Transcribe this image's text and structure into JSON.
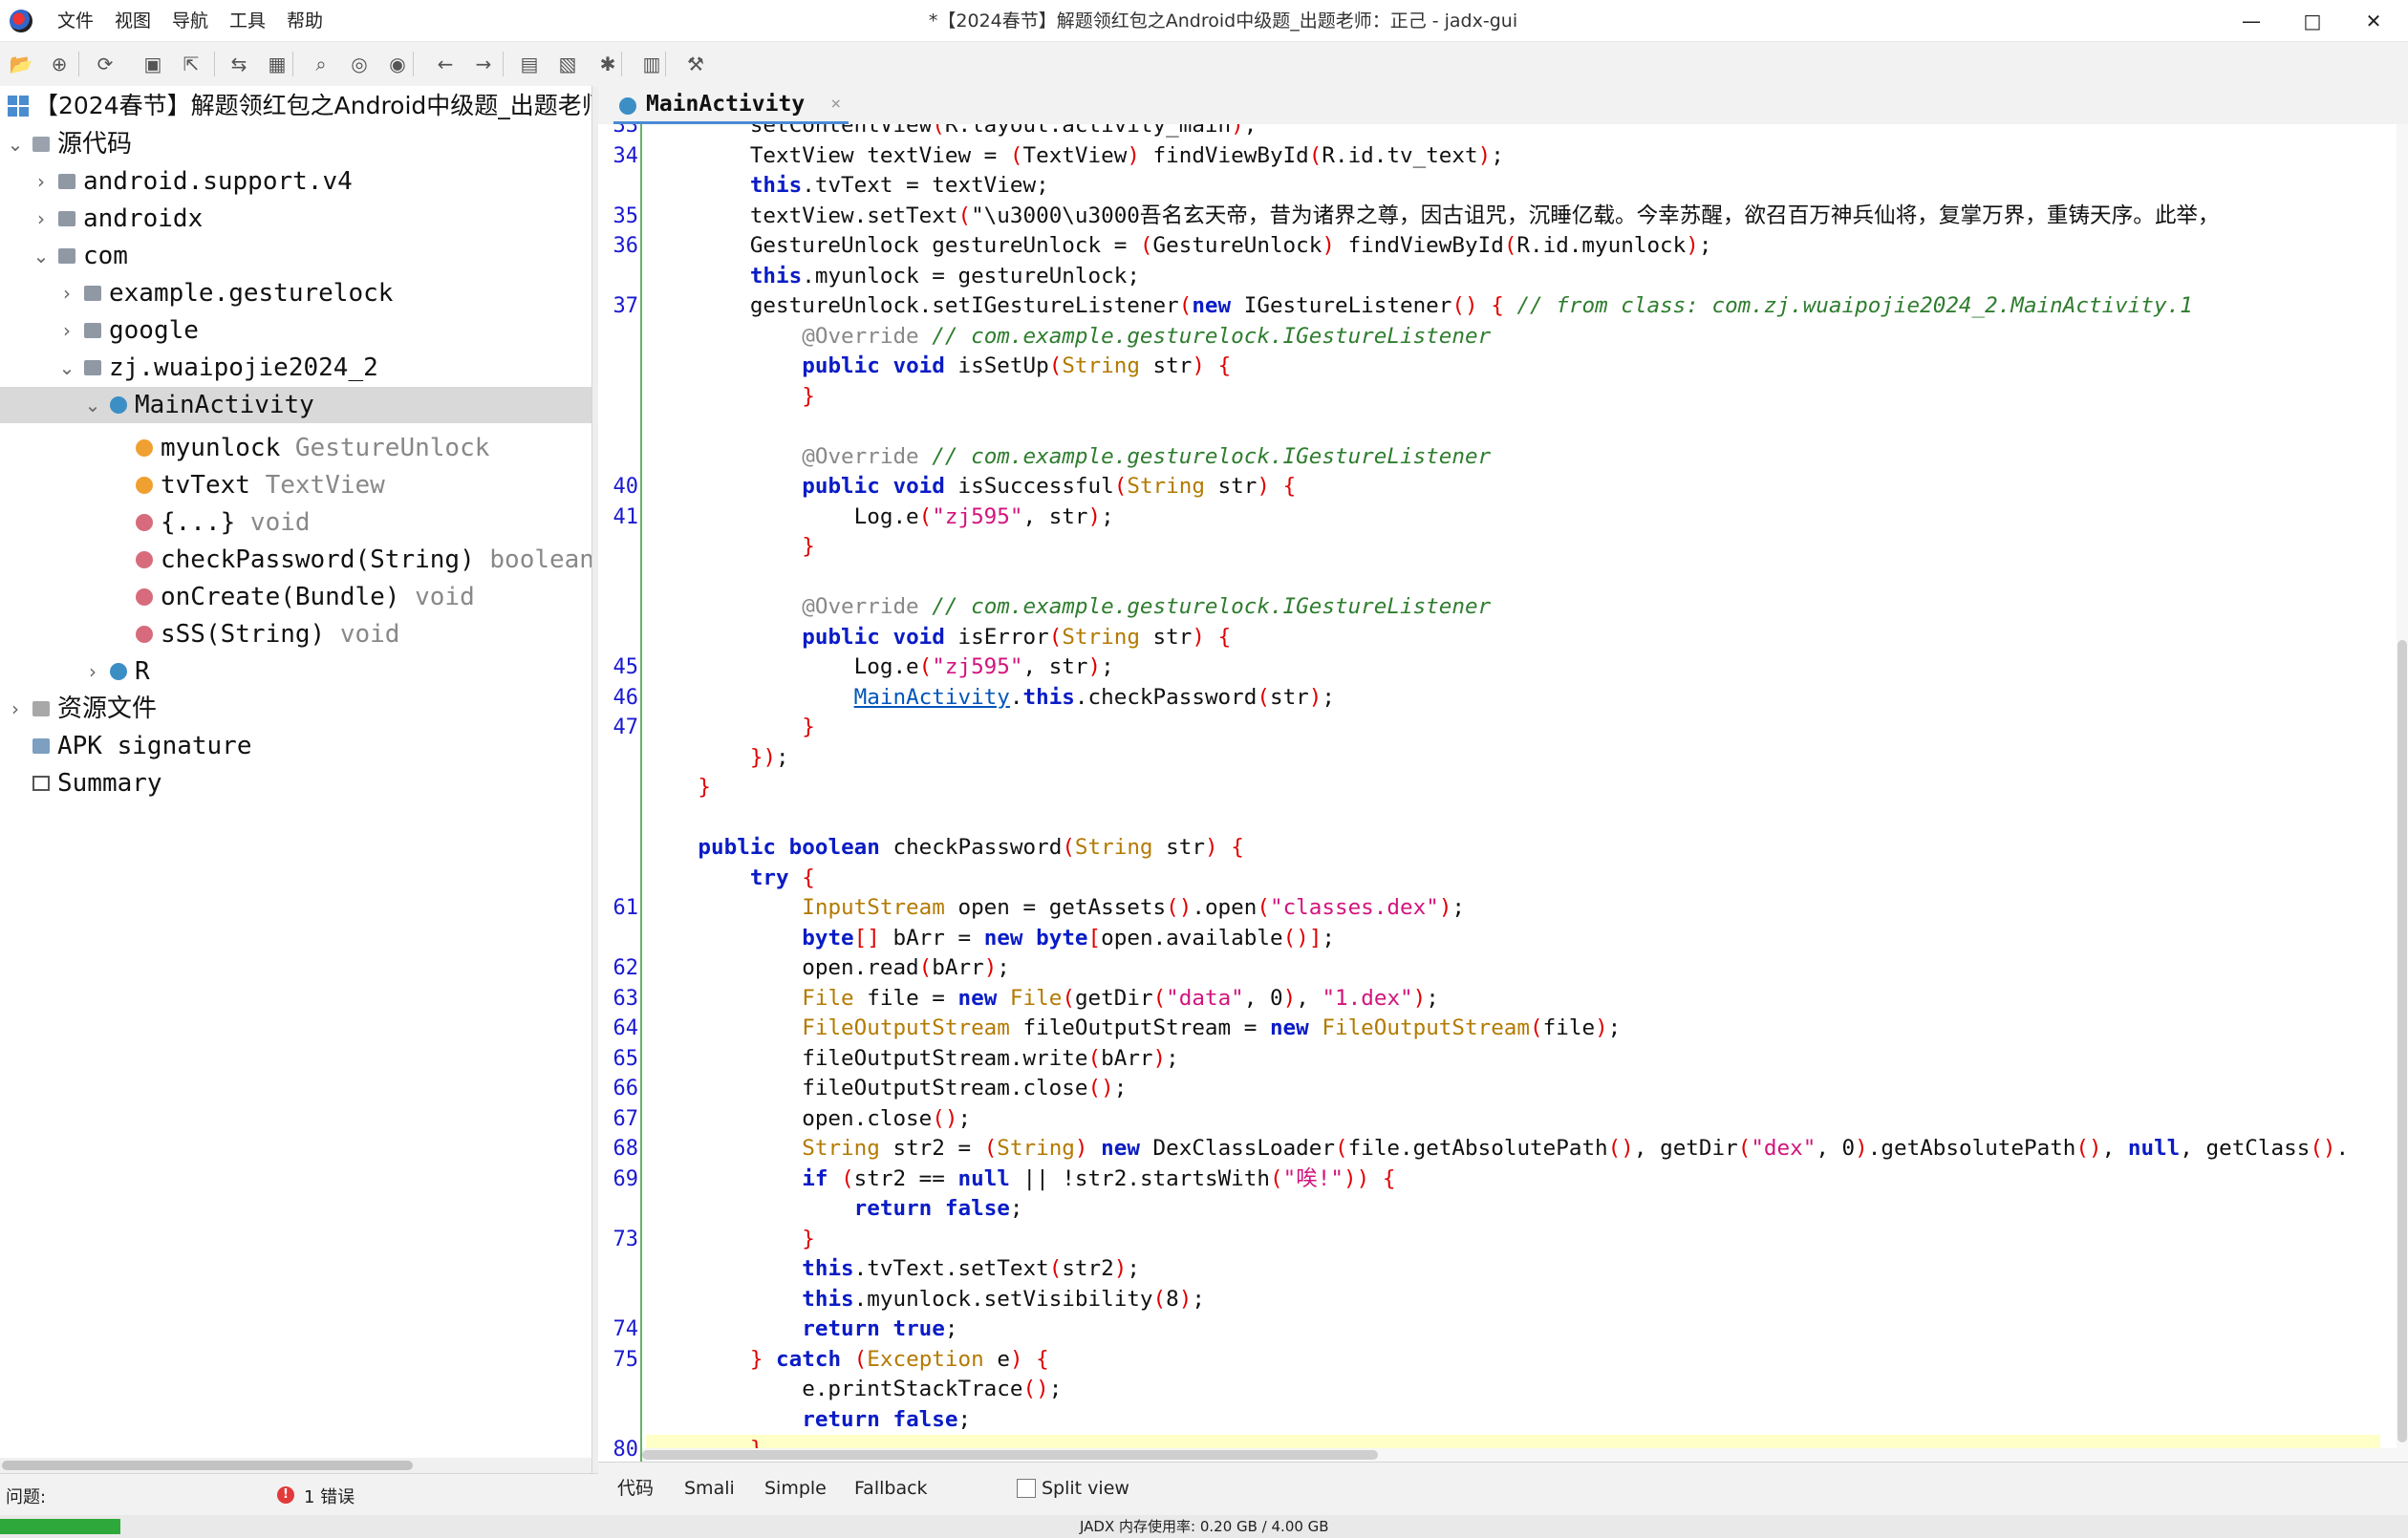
{
  "window": {
    "title": "*【2024春节】解题领红包之Android中级题_出题老师：正己 - jadx-gui",
    "menu": [
      "文件",
      "视图",
      "导航",
      "工具",
      "帮助"
    ],
    "controls": {
      "minimize": "—",
      "maximize": "□",
      "close": "✕"
    }
  },
  "toolbar": {
    "buttons": [
      "open-icon",
      "add-files-icon",
      "reload-icon",
      "save-icon",
      "export-icon",
      "sync-icon",
      "flatten-icon",
      "search-icon",
      "find-class-icon",
      "find-usage-icon",
      "back-icon",
      "forward-icon",
      "log-icon",
      "bookmark-icon",
      "debug-icon",
      "log-viewer-icon",
      "settings-icon"
    ]
  },
  "tree": [
    {
      "label": "【2024春节】解题领红包之Android中级题_出题老师：正己",
      "type": "",
      "icon": "project-icon",
      "arrow": ""
    },
    {
      "label": "源代码",
      "type": "",
      "icon": "source-icon",
      "arrow": "⌄"
    },
    {
      "label": "android.support.v4",
      "type": "",
      "icon": "package-icon",
      "arrow": "›"
    },
    {
      "label": "androidx",
      "type": "",
      "icon": "package-icon",
      "arrow": "›"
    },
    {
      "label": "com",
      "type": "",
      "icon": "package-icon",
      "arrow": "⌄"
    },
    {
      "label": "example.gesturelock",
      "type": "",
      "icon": "package-icon",
      "arrow": "›"
    },
    {
      "label": "google",
      "type": "",
      "icon": "package-icon",
      "arrow": "›"
    },
    {
      "label": "zj.wuaipojie2024_2",
      "type": "",
      "icon": "package-icon",
      "arrow": "⌄"
    },
    {
      "label": "MainActivity",
      "type": "",
      "icon": "class-icon",
      "arrow": "⌄"
    },
    {
      "label": "myunlock",
      "type": "GestureUnlock",
      "icon": "field-icon",
      "arrow": ""
    },
    {
      "label": "tvText",
      "type": "TextView",
      "icon": "field-icon",
      "arrow": ""
    },
    {
      "label": "{...}",
      "type": "void",
      "icon": "method-icon",
      "arrow": ""
    },
    {
      "label": "checkPassword(String)",
      "type": "boolean",
      "icon": "method-icon",
      "arrow": ""
    },
    {
      "label": "onCreate(Bundle)",
      "type": "void",
      "icon": "method-icon",
      "arrow": ""
    },
    {
      "label": "sSS(String)",
      "type": "void",
      "icon": "method-icon",
      "arrow": ""
    },
    {
      "label": "R",
      "type": "",
      "icon": "class-icon",
      "arrow": "›"
    },
    {
      "label": "资源文件",
      "type": "",
      "icon": "resources-icon",
      "arrow": "›"
    },
    {
      "label": "APK signature",
      "type": "",
      "icon": "signature-icon",
      "arrow": ""
    },
    {
      "label": "Summary",
      "type": "",
      "icon": "summary-icon",
      "arrow": ""
    }
  ],
  "editor": {
    "tab_label": "MainActivity",
    "tab_close": "×",
    "line_numbers": [
      "33",
      "34",
      "",
      "35",
      "36",
      "",
      "37",
      "",
      "",
      "",
      "",
      "",
      "40",
      "41",
      "",
      "",
      "",
      "",
      "45",
      "46",
      "47",
      "",
      "",
      "",
      "",
      "",
      "61",
      "",
      "62",
      "63",
      "64",
      "65",
      "66",
      "67",
      "68",
      "69",
      "",
      "73",
      "",
      "",
      "74",
      "75",
      "",
      "",
      "80",
      "",
      ""
    ],
    "code": [
      "        setContentView(R.layout.activity_main);",
      "        TextView textView = (TextView) findViewById(R.id.tv_text);",
      "        this.tvText = textView;",
      "        textView.setText(\"\\u3000\\u3000吾名玄天帝，昔为诸界之尊，因古诅咒，沉睡亿载。今幸苏醒，欲召百万神兵仙将，复掌万界，重铸天序。此举，",
      "        GestureUnlock gestureUnlock = (GestureUnlock) findViewById(R.id.myunlock);",
      "        this.myunlock = gestureUnlock;",
      "        gestureUnlock.setIGestureListener(new IGestureListener() { // from class: com.zj.wuaipojie2024_2.MainActivity.1",
      "            @Override // com.example.gesturelock.IGestureListener",
      "            public void isSetUp(String str) {",
      "            }",
      "",
      "            @Override // com.example.gesturelock.IGestureListener",
      "            public void isSuccessful(String str) {",
      "                Log.e(\"zj595\", str);",
      "            }",
      "",
      "            @Override // com.example.gesturelock.IGestureListener",
      "            public void isError(String str) {",
      "                Log.e(\"zj595\", str);",
      "                MainActivity.this.checkPassword(str);",
      "            }",
      "        });",
      "    }",
      "",
      "    public boolean checkPassword(String str) {",
      "        try {",
      "            InputStream open = getAssets().open(\"classes.dex\");",
      "            byte[] bArr = new byte[open.available()];",
      "            open.read(bArr);",
      "            File file = new File(getDir(\"data\", 0), \"1.dex\");",
      "            FileOutputStream fileOutputStream = new FileOutputStream(file);",
      "            fileOutputStream.write(bArr);",
      "            fileOutputStream.close();",
      "            open.close();",
      "            String str2 = (String) new DexClassLoader(file.getAbsolutePath(), getDir(\"dex\", 0).getAbsolutePath(), null, getClass().",
      "            if (str2 == null || !str2.startsWith(\"唉!\")) {",
      "                return false;",
      "            }",
      "            this.tvText.setText(str2);",
      "            this.myunlock.setVisibility(8);",
      "            return true;",
      "        } catch (Exception e) {",
      "            e.printStackTrace();",
      "            return false;",
      "        }"
    ],
    "highlighted_line": "80"
  },
  "bottom_tabs": [
    "代码",
    "Smali",
    "Simple",
    "Fallback"
  ],
  "split_view_label": "Split view",
  "problems": {
    "label": "问题:",
    "error_text": "1 错误",
    "error_icon": "!"
  },
  "status": {
    "memory_text": "JADX 内存使用率:  0.20 GB / 4.00 GB",
    "memory_fraction": 0.05
  }
}
